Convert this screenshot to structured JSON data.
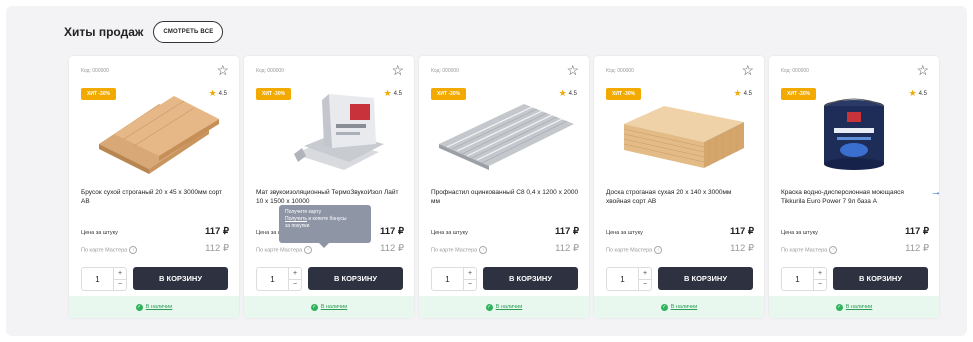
{
  "section": {
    "title": "Хиты продаж",
    "see_all_label": "СМОТРЕТЬ ВСЕ"
  },
  "common": {
    "price_label": "Цена за штуку",
    "card_price_label": "По карте Мастера",
    "cart_label": "В КОРЗИНУ",
    "stock_label": "В наличии",
    "currency": "₽"
  },
  "tooltip": {
    "text_1": "Получите карту",
    "link": "Получить",
    "text_2": "и копите бонусы",
    "text_3": "за покупки"
  },
  "products": [
    {
      "code": "Код: 000000",
      "badge": "ХИТ -30%",
      "rating": "4.5",
      "name": "Брусок сухой строганый 20 х 45 х 3000мм сорт АВ",
      "price": "117 ₽",
      "card_price": "112 ₽",
      "qty": "1",
      "image": "wood-planks"
    },
    {
      "code": "Код: 000000",
      "badge": "ХИТ -30%",
      "rating": "4.5",
      "name": "Мат звукоизоляционный ТермоЗвукоИзол Лайт 10 х 1500 х 10000",
      "price": "117 ₽",
      "card_price": "112 ₽",
      "qty": "1",
      "image": "insulation-bags"
    },
    {
      "code": "Код: 000000",
      "badge": "ХИТ -30%",
      "rating": "4.5",
      "name": "Профнастил оцинкованный С8 0,4 х 1200 х 2000 мм",
      "price": "117 ₽",
      "card_price": "112 ₽",
      "qty": "1",
      "image": "metal-sheet"
    },
    {
      "code": "Код: 000000",
      "badge": "ХИТ -30%",
      "rating": "4.5",
      "name": "Доска строганая сухая 20 х 140 х 3000мм хвойная сорт АВ",
      "price": "117 ₽",
      "card_price": "112 ₽",
      "qty": "1",
      "image": "lumber-stack"
    },
    {
      "code": "Код: 000000",
      "badge": "ХИТ -30%",
      "rating": "4.5",
      "name": "Краска водно-дисперсионная моющаяся Tikkurila Euro Power 7 9л база А",
      "price": "117 ₽",
      "card_price": "112 ₽",
      "qty": "1",
      "image": "paint-bucket"
    }
  ],
  "colors": {
    "badge": "#f2a900",
    "button": "#2e3240",
    "stock_bg": "#e8f8ee",
    "stock_text": "#2a9d52",
    "arrow": "#1f5fcf"
  }
}
